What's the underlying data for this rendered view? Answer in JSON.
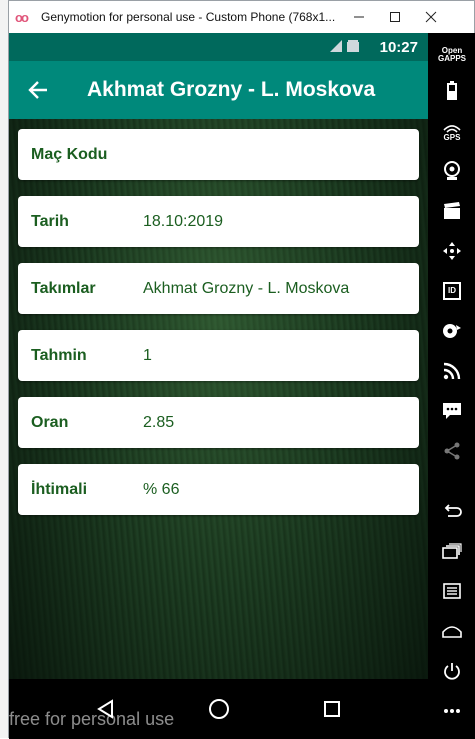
{
  "host": {
    "window_title": "Genymotion for personal use - Custom Phone (768x1...",
    "app_icon": "oo",
    "watermark": "free for personal use",
    "sidebar": {
      "open_gapps": "Open GAPPS",
      "gps": "GPS",
      "id": "ID"
    }
  },
  "status_bar": {
    "time": "10:27"
  },
  "app_bar": {
    "title": "Akhmat Grozny - L. Moskova"
  },
  "details": [
    {
      "label": "Maç Kodu",
      "value": ""
    },
    {
      "label": "Tarih",
      "value": "18.10:2019"
    },
    {
      "label": "Takımlar",
      "value": "Akhmat Grozny - L. Moskova"
    },
    {
      "label": "Tahmin",
      "value": "1"
    },
    {
      "label": "Oran",
      "value": "2.85"
    },
    {
      "label": "İhtimali",
      "value": "% 66"
    }
  ],
  "colors": {
    "status_bar": "#00695c",
    "app_bar": "#00897b",
    "label_text": "#1b5e20"
  }
}
